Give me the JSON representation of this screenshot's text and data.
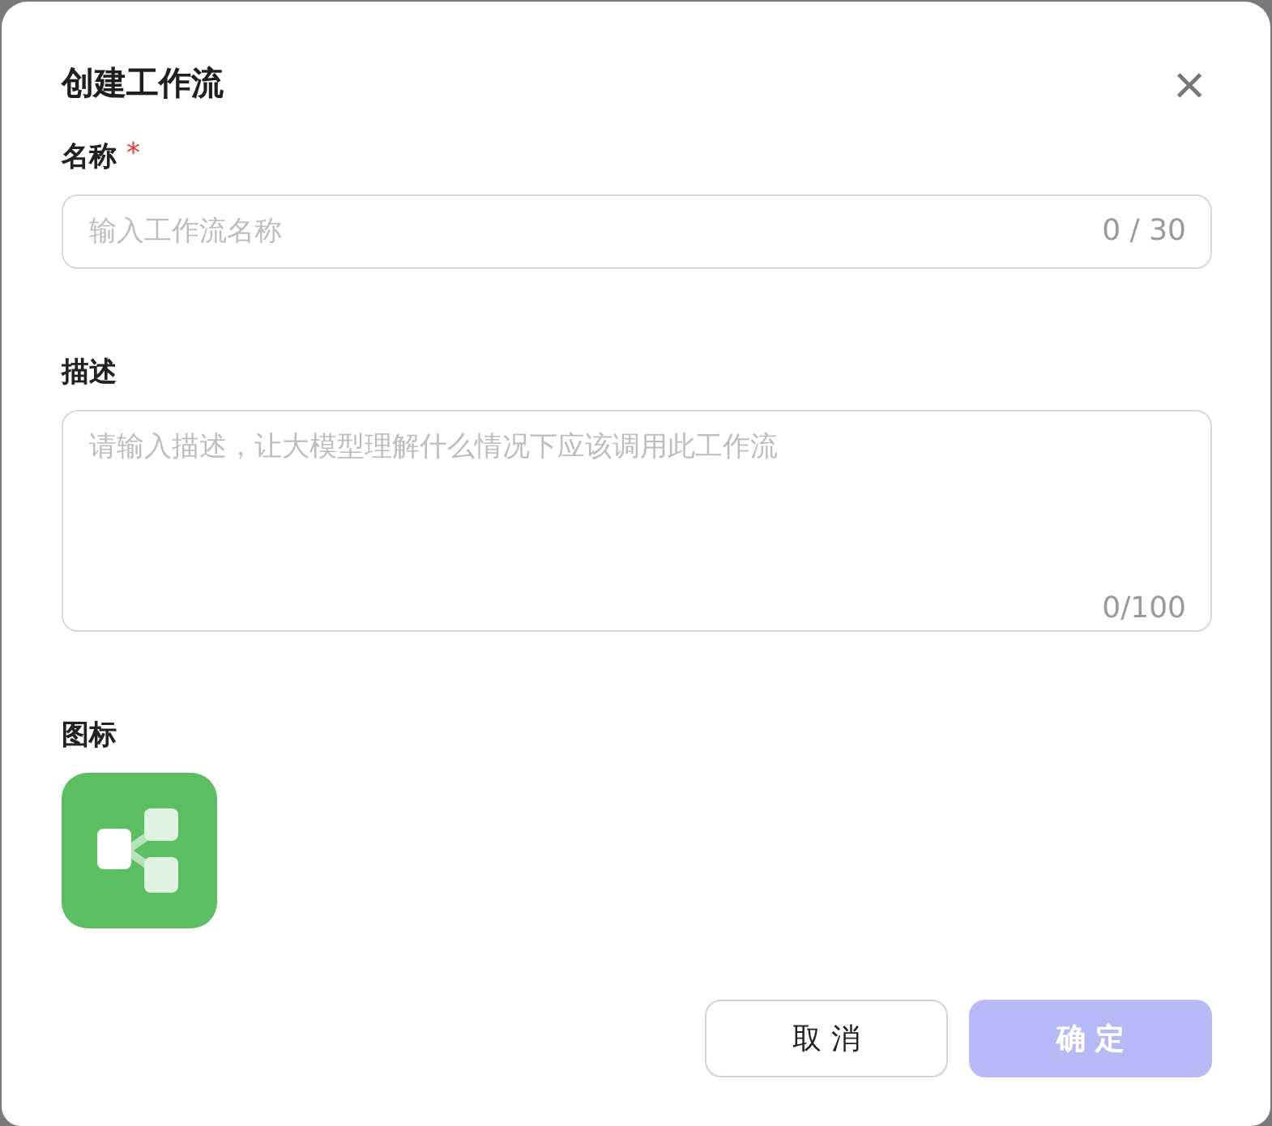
{
  "dialog": {
    "title": "创建工作流",
    "close": "×"
  },
  "fields": [
    {
      "kind": "input",
      "label": "名称",
      "required_mark": "*",
      "placeholder": "输入工作流名称",
      "counter": "0 / 30"
    },
    {
      "kind": "textarea",
      "label": "描述",
      "placeholder": "请输入描述，让大模型理解什么情况下应该调用此工作流",
      "counter": "0/100"
    }
  ],
  "icon_field": {
    "label": "图标"
  },
  "buttons": [
    {
      "label": "取消",
      "kind": "secondary",
      "disabled": false
    },
    {
      "label": "确定",
      "kind": "primary",
      "disabled": true
    }
  ]
}
